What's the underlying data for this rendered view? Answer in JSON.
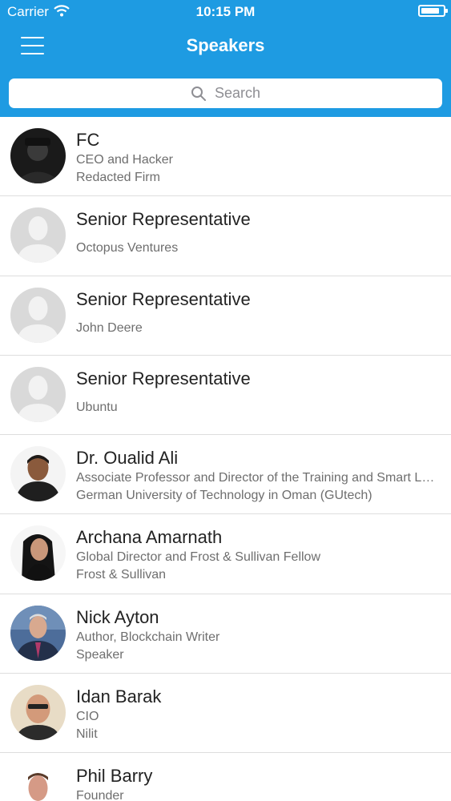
{
  "status_bar": {
    "carrier": "Carrier",
    "time": "10:15 PM"
  },
  "nav": {
    "title": "Speakers",
    "menu_icon": "hamburger-menu-icon"
  },
  "search": {
    "placeholder": "Search"
  },
  "speakers": [
    {
      "name": "FC",
      "line1": "CEO and Hacker",
      "line2": "Redacted Firm",
      "avatar": "photo"
    },
    {
      "name": "Senior Representative",
      "line1": "",
      "line2": "Octopus Ventures",
      "avatar": "placeholder"
    },
    {
      "name": "Senior Representative",
      "line1": "",
      "line2": "John Deere",
      "avatar": "placeholder"
    },
    {
      "name": "Senior Representative",
      "line1": "",
      "line2": "Ubuntu",
      "avatar": "placeholder"
    },
    {
      "name": "Dr. Oualid Ali",
      "line1": "Associate Professor and Director of the Training and Smart Learning Center",
      "line2": "German University of Technology in Oman (GUtech)",
      "avatar": "photo"
    },
    {
      "name": "Archana Amarnath",
      "line1": "Global Director and Frost & Sullivan Fellow",
      "line2": "Frost & Sullivan",
      "avatar": "photo"
    },
    {
      "name": "Nick Ayton",
      "line1": "Author, Blockchain Writer",
      "line2": "Speaker",
      "avatar": "photo"
    },
    {
      "name": "Idan Barak",
      "line1": "CIO",
      "line2": "Nilit",
      "avatar": "photo"
    },
    {
      "name": "Phil Barry",
      "line1": "Founder",
      "line2": "",
      "avatar": "photo"
    }
  ],
  "colors": {
    "header": "#1e9be2",
    "separator": "#dedede",
    "secondary_text": "#6e6e6e"
  }
}
